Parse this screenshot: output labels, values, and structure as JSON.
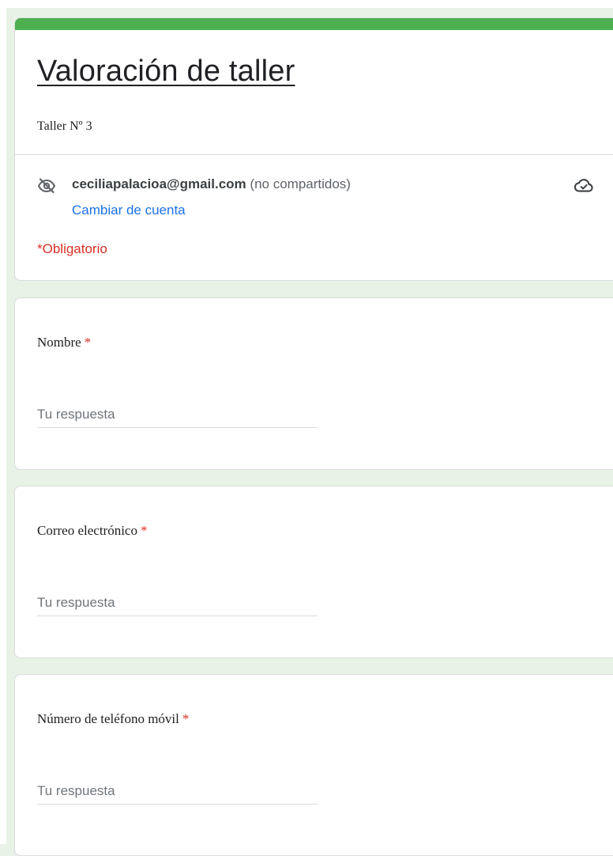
{
  "form": {
    "title": "Valoración de taller",
    "description": "Taller Nº 3",
    "account": {
      "email": "ceciliapalacioa@gmail.com",
      "visibility": "(no compartidos)",
      "switch_label": "Cambiar de cuenta"
    },
    "required_note": "*Obligatorio",
    "accent_color": "#4caf50",
    "icons": [
      "visibility-off-icon",
      "cloud-done-icon"
    ]
  },
  "questions": [
    {
      "label": "Nombre",
      "required_mark": "*",
      "placeholder": "Tu respuesta"
    },
    {
      "label": "Correo electrónico",
      "required_mark": "*",
      "placeholder": "Tu respuesta"
    },
    {
      "label": "Número de teléfono móvil",
      "required_mark": "*",
      "placeholder": "Tu respuesta"
    }
  ]
}
